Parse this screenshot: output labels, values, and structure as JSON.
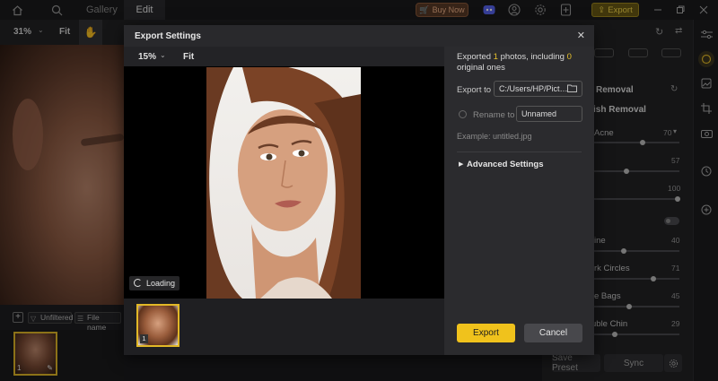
{
  "topbar": {
    "tabs": [
      {
        "label": "Gallery"
      },
      {
        "label": "Edit"
      }
    ],
    "buy_now_label": "Buy Now",
    "export_label": "Export"
  },
  "toolbar": {
    "zoom": "31%",
    "fit_label": "Fit"
  },
  "filmstrip": {
    "filter_label": "Unfiltered",
    "sort_label": "File name",
    "thumb_number": "1"
  },
  "right_panel": {
    "items": [
      {
        "label": "Removal"
      },
      {
        "label": "ish Removal"
      },
      {
        "label": "Acne",
        "value": "70"
      },
      {
        "label": "",
        "value": "57"
      },
      {
        "label": "",
        "value": "100"
      },
      {
        "label": "ine",
        "value": "40"
      },
      {
        "label": "rk Circles",
        "value": "71"
      },
      {
        "label": "e Bags",
        "value": "45"
      },
      {
        "label": "uble Chin",
        "value": "29"
      }
    ],
    "save_preset_label": "Save Preset",
    "sync_label": "Sync"
  },
  "dialog": {
    "title": "Export Settings",
    "zoom": "15%",
    "fit_label": "Fit",
    "loading_label": "Loading",
    "thumb_number": "1",
    "exported_prefix": "Exported ",
    "exported_count": "1",
    "exported_middle": " photos, including ",
    "exported_original": "0",
    "exported_suffix": " original ones",
    "export_to_label": "Export to",
    "export_path": "C:/Users/HP/Pict…",
    "rename_label": "Rename to",
    "rename_value": "Unnamed",
    "example_label": "Example: untitled.jpg",
    "advanced_label": "Advanced Settings",
    "export_button": "Export",
    "cancel_button": "Cancel"
  },
  "colors": {
    "accent": "#f0c21c",
    "thumb_border": "#e2b827",
    "dialog_bg": "#29292c"
  }
}
